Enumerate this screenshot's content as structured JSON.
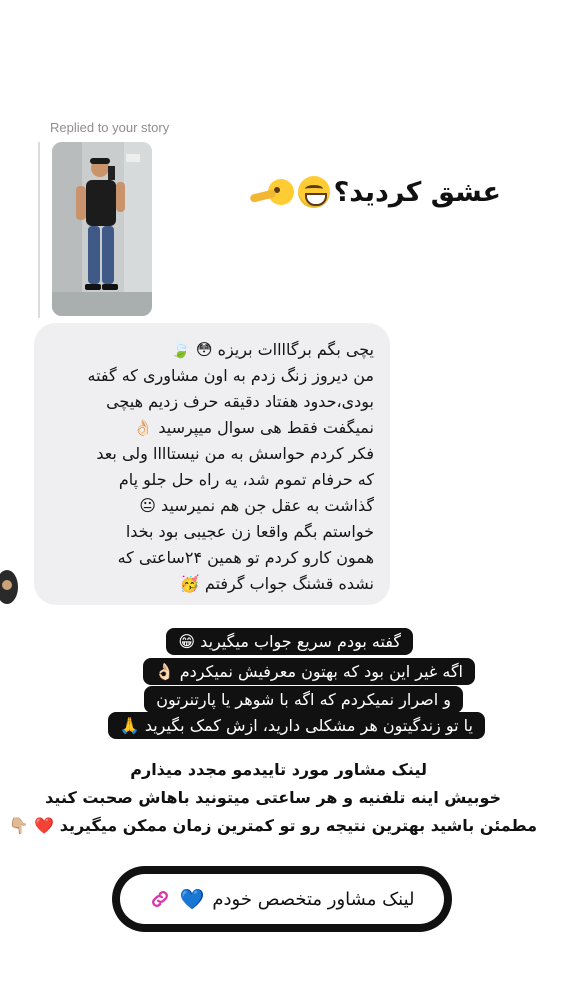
{
  "reply": {
    "label": "Replied to your story"
  },
  "story": {
    "caption": "عشق کردید؟"
  },
  "message": {
    "lines": [
      "یچی بگم برگاااات بریزه 😳 🍃",
      "من دیروز زنگ زدم به اون مشاوری که گفته",
      "بودی،حدود هفتاد دقیقه حرف زدیم هیچی",
      "نمیگفت فقط هی سوال میپرسید 👌🏻",
      "فکر کردم حواسش به من نیستاااا ولی بعد",
      "که حرفام تموم شد، یه راه حل جلو پام",
      "گذاشت به عقل جن هم نمیرسید 😐",
      "خواستم بگم واقعا زن عجیبی بود بخدا",
      "همون کارو کردم تو همین ۲۴ساعتی که",
      "نشده قشنگ جواب گرفتم 🥳"
    ]
  },
  "overlay_dark": [
    "گفته بودم سریع جواب میگیرید 😁",
    "اگه غیر این بود که بهتون معرفیش نمیکردم 👌🏻",
    "و اصرار نمیکردم که اگه با شوهر یا پارتنرتون",
    "یا تو زندگیتون هر مشکلی دارید، ازش کمک بگیرید 🙏"
  ],
  "overlay_plain": [
    "لینک مشاور مورد تاییدمو مجدد میذارم",
    "خوبیش اینه تلفنیه و هر ساعتی میتونید باهاش صحبت کنید",
    "مطمئن باشید بهترین نتیجه رو تو کمترین زمان ممکن میگیرید ❤️ 👇🏼"
  ],
  "link_sticker": {
    "label": "لینک مشاور متخصص خودم",
    "heart": "💙",
    "icon": "link-icon"
  },
  "colors": {
    "bubble": "#efeff1",
    "dark_block": "#111111",
    "link_icon": "#d63aa8",
    "heart_blue": "#7cc6f2"
  }
}
